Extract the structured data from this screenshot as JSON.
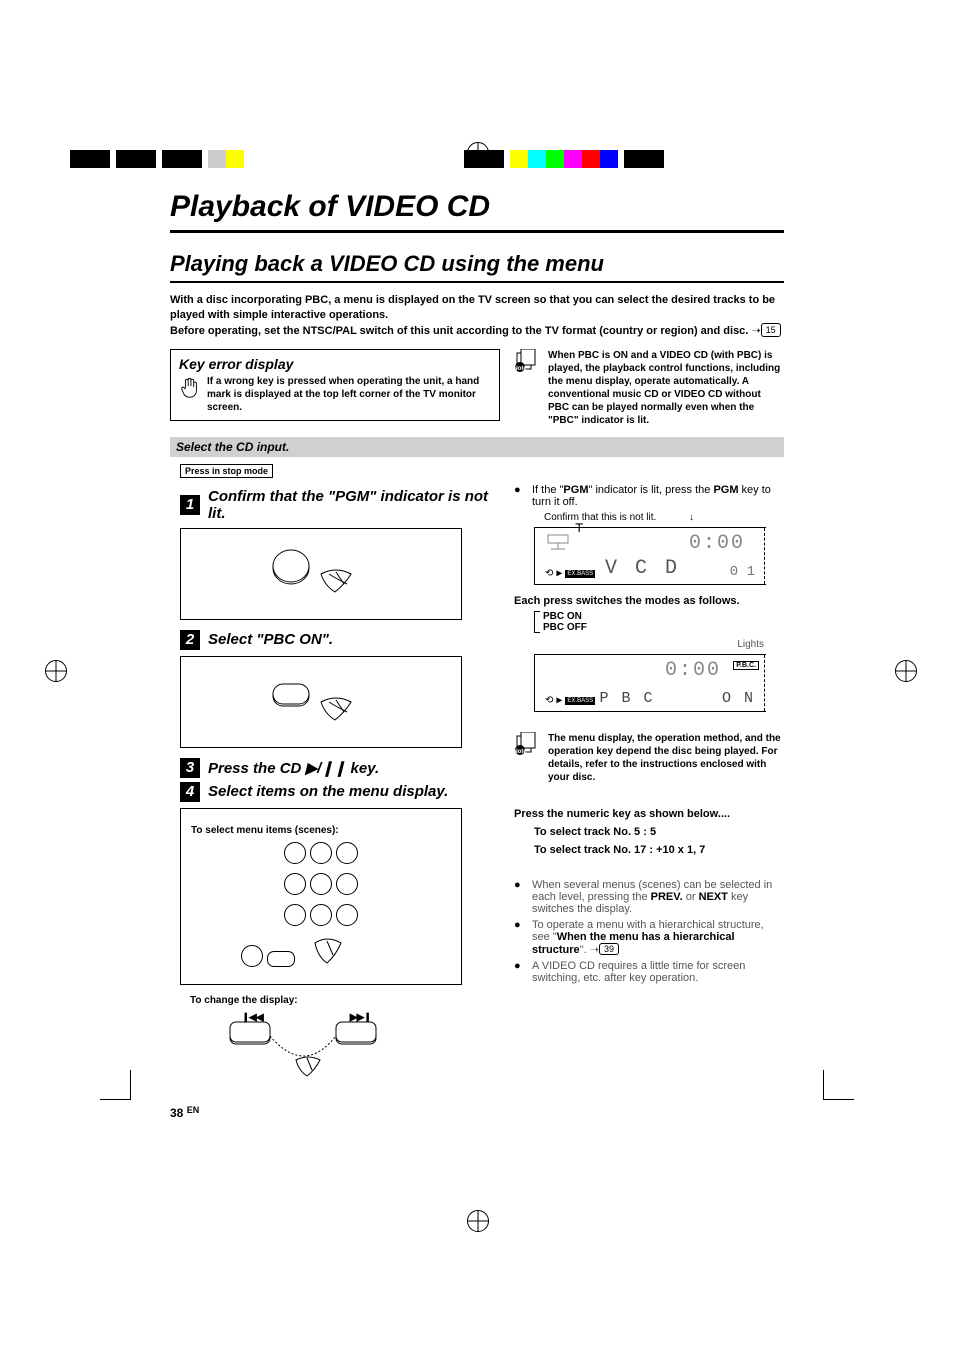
{
  "title": "Playback of VIDEO CD",
  "subtitle": "Playing back a VIDEO CD using the menu",
  "intro_p1": "With a disc incorporating PBC, a menu is displayed on the TV screen so that you can select the desired tracks to be played with simple interactive operations.",
  "intro_p2": "Before operating, set the NTSC/PAL switch of this unit according to the TV format (country or region) and disc.",
  "intro_ref": "15",
  "key_error": {
    "title": "Key error display",
    "body": "If a wrong key is pressed when operating the unit, a hand mark is displayed at the top left corner of the TV monitor screen."
  },
  "note1": "When PBC is ON and a VIDEO CD (with PBC) is played, the playback control functions, including the menu display, operate automatically. A conventional music CD or VIDEO CD without PBC can be played normally even when the \"PBC\" indicator is lit.",
  "select_cd": "Select the CD input.",
  "press_stop": "Press in stop mode",
  "steps": {
    "s1": "Confirm that the \"PGM\" indicator is not lit.",
    "s2": "Select \"PBC ON\".",
    "s3": "Press the CD ▶/❙❙ key.",
    "s4": "Select items on the menu display."
  },
  "s1_bullet_a": "If the \"",
  "s1_bullet_b": "PGM",
  "s1_bullet_c": "\" indicator is lit, press the ",
  "s1_bullet_d": "PGM",
  "s1_bullet_e": " key to turn it off.",
  "confirm_not_lit": "Confirm that this is not lit.",
  "lcd1": {
    "time": "0:00",
    "main": "V C D",
    "track": "0 1",
    "badge": "EX.BASS"
  },
  "each_press": "Each press switches the modes as follows.",
  "modes": {
    "on": "PBC ON",
    "off": "PBC OFF",
    "lights": "Lights"
  },
  "lcd2": {
    "time": "0:00",
    "main_left": "P B C",
    "main_right": "O N",
    "badge": "EX.BASS",
    "pbc": "P.B.C."
  },
  "note2": "The menu display, the operation method, and the operation key depend the disc being played. For details, refer to the instructions enclosed with your disc.",
  "select_menu": "To select menu items (scenes):",
  "change_display": "To change the display:",
  "press_numeric": "Press the numeric key as shown below....",
  "sel5": "To select track No. 5   :  5",
  "sel17": "To select track No. 17 :  +10 x 1, 7",
  "bottom_b1a": "When several menus (scenes) can be selected in each level, pressing the ",
  "bottom_b1b": "PREV.",
  "bottom_b1c": " or ",
  "bottom_b1d": "NEXT",
  "bottom_b1e": " key switches the display.",
  "bottom_b2a": "To operate a menu with a hierarchical structure, see \"",
  "bottom_b2b": "When the menu has a hierarchical structure",
  "bottom_b2c": "\".",
  "bottom_b2_ref": "39",
  "bottom_b3": "A VIDEO CD requires a little time for screen switching, etc. after key operation.",
  "page_num": "38",
  "page_lang": "EN",
  "prev_label": "❙◀◀",
  "next_label": "▶▶❙"
}
